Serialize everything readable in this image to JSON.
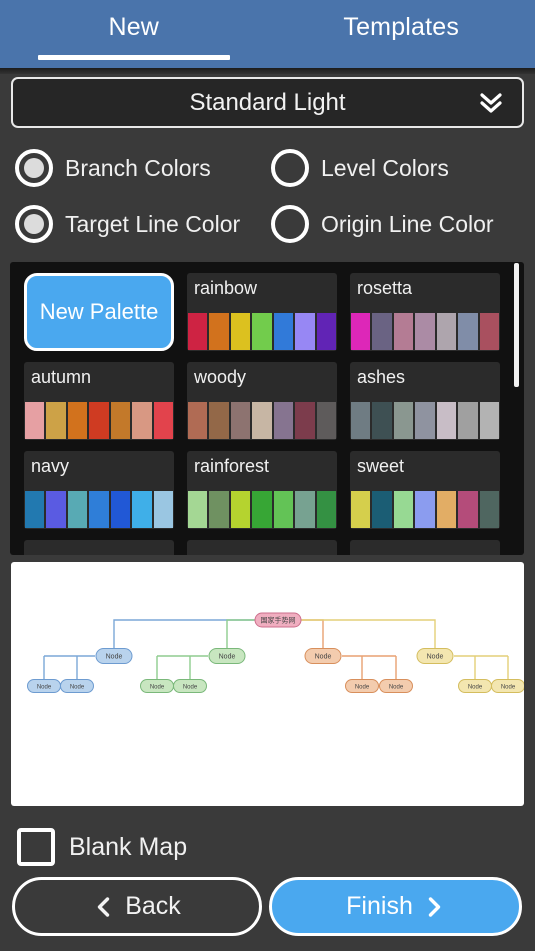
{
  "tabs": [
    {
      "label": "New",
      "active": true,
      "name": "tab-new"
    },
    {
      "label": "Templates",
      "active": false,
      "name": "tab-templates"
    }
  ],
  "theme_select": {
    "value": "Standard Light",
    "icon": "chevron-double-down-icon"
  },
  "color_options": [
    {
      "label": "Branch Colors",
      "selected": true
    },
    {
      "label": "Level Colors",
      "selected": false
    },
    {
      "label": "Target Line Color",
      "selected": true
    },
    {
      "label": "Origin Line Color",
      "selected": false
    }
  ],
  "palettes": {
    "new_palette_label": "New Palette",
    "items": [
      {
        "name": "rainbow",
        "colors": [
          "#ce2343",
          "#d2721d",
          "#dcc11f",
          "#72cc4c",
          "#317ad9",
          "#9787f4",
          "#6124b5"
        ]
      },
      {
        "name": "rosetta",
        "colors": [
          "#dd27b8",
          "#6a6383",
          "#b47c94",
          "#ab8ba5",
          "#aea5ad",
          "#808da8",
          "#a9505f"
        ]
      },
      {
        "name": "autumn",
        "colors": [
          "#e6a0a3",
          "#cda247",
          "#d2721d",
          "#cf3b22",
          "#c3792a",
          "#d89883",
          "#e2434c"
        ]
      },
      {
        "name": "woody",
        "colors": [
          "#b06b54",
          "#936848",
          "#8d7370",
          "#c7b6a4",
          "#867490",
          "#7c3c4c",
          "#5e5b5b"
        ]
      },
      {
        "name": "ashes",
        "colors": [
          "#6f7c83",
          "#3e5053",
          "#8a9790",
          "#8f93a0",
          "#c8bdc6",
          "#a0a0a0",
          "#b3b3b3"
        ]
      },
      {
        "name": "navy",
        "colors": [
          "#2279b0",
          "#5a5be2",
          "#58aab4",
          "#2f7ed8",
          "#2158d6",
          "#3fafe8",
          "#9ac6e2"
        ]
      },
      {
        "name": "rainforest",
        "colors": [
          "#a4d794",
          "#6f9161",
          "#b5d32f",
          "#37a635",
          "#63c356",
          "#77a291",
          "#349143"
        ]
      },
      {
        "name": "sweet",
        "colors": [
          "#d5cf4c",
          "#1b5d74",
          "#97d993",
          "#8b9cef",
          "#e2ad65",
          "#b44c7a",
          "#4f6660"
        ]
      }
    ]
  },
  "preview": {
    "root_label": "国家手势网",
    "node_label": "Node",
    "branches": [
      {
        "color_line": "#7ba7d7",
        "color_fill": "#b9d3ed",
        "color_stroke": "#6d9bd0"
      },
      {
        "color_line": "#8fcc8f",
        "color_fill": "#c8e6c0",
        "color_stroke": "#7ab87a"
      },
      {
        "color_line": "#e8a172",
        "color_fill": "#f3ccae",
        "color_stroke": "#d88f5c"
      },
      {
        "color_line": "#e3cf78",
        "color_fill": "#f3e6b0",
        "color_stroke": "#d4bd5e"
      }
    ],
    "root_fill": "#f0aec0",
    "root_stroke": "#cd6f8c"
  },
  "blank_map": {
    "label": "Blank Map",
    "checked": false
  },
  "footer": {
    "back_label": "Back",
    "finish_label": "Finish",
    "back_icon": "chevron-left-icon",
    "finish_icon": "chevron-right-icon"
  },
  "colors": {
    "tabbar_bg": "#4a74ab",
    "page_bg": "#3a3a3a",
    "panel_bg": "#111111",
    "card_bg": "#2b2b2b",
    "accent": "#4aa8ef",
    "text": "#f0f0f0"
  }
}
